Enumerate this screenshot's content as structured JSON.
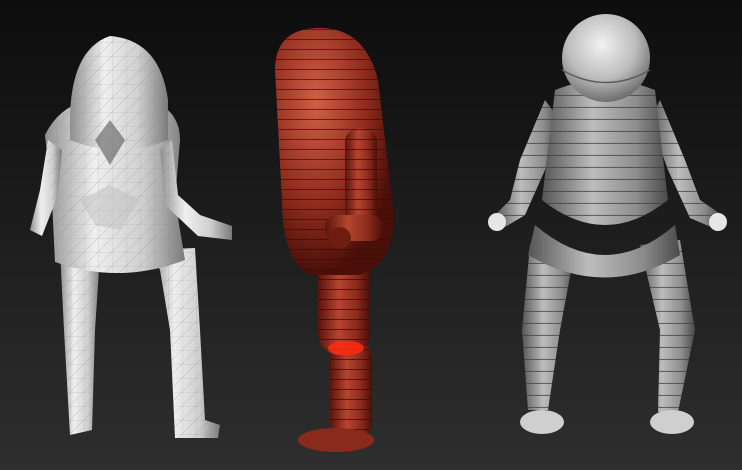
{
  "scene": {
    "description_visible_text": "",
    "models": [
      {
        "id": "model-low-poly",
        "material": "matcap-white-wireframe"
      },
      {
        "id": "model-side-red",
        "material": "matcap-red-wax",
        "selected_region": "knee"
      },
      {
        "id": "model-zsphere-gray",
        "material": "matcap-gray"
      }
    ]
  },
  "colors": {
    "background_top": "#0d0d0d",
    "background_bottom": "#2e2e2e",
    "white_model": "#d9d9d9",
    "red_model": "#8a2a1c",
    "gray_model": "#9a9a9a",
    "highlight": "#ff2a10"
  }
}
